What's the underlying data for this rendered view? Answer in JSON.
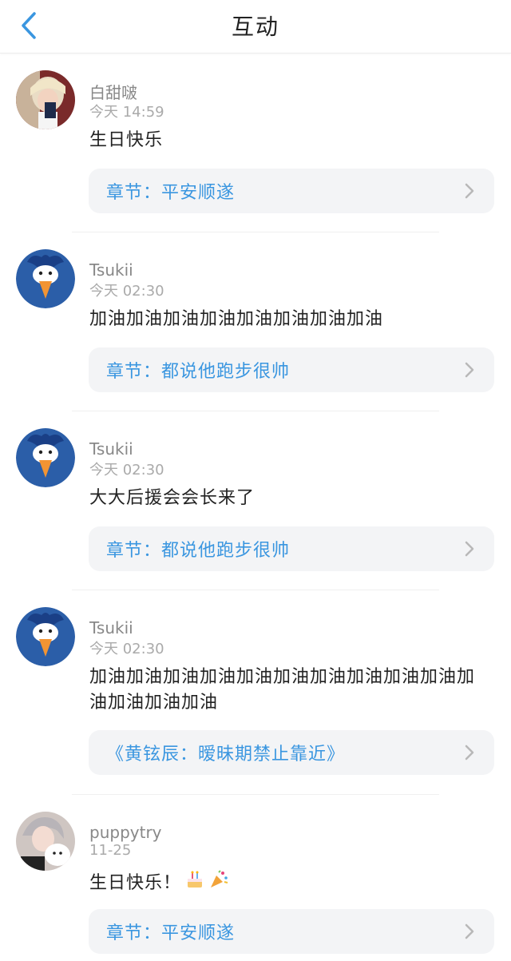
{
  "header": {
    "title": "互动"
  },
  "comments": [
    {
      "username": "白甜啵",
      "time": "今天 14:59",
      "content": "生日快乐",
      "chapter": "章节：平安顺遂"
    },
    {
      "username": "Tsukii",
      "time": "今天 02:30",
      "content": "加油加油加油加油加油加油加油加油",
      "chapter": "章节：都说他跑步很帅"
    },
    {
      "username": "Tsukii",
      "time": "今天 02:30",
      "content": "大大后援会会长来了",
      "chapter": "章节：都说他跑步很帅"
    },
    {
      "username": "Tsukii",
      "time": "今天 02:30",
      "content": "加油加油加油加油加油加油加油加油加油加油加油加油加油加油",
      "chapter": "《黄铉辰：暧昧期禁止靠近》"
    },
    {
      "username": "puppytry",
      "time": "11-25",
      "content": "生日快乐！",
      "chapter": "章节：平安顺遂"
    }
  ],
  "colors": {
    "accent": "#3a96e0",
    "card": "#f3f4f6"
  },
  "icons": {
    "back": "chevron-left-icon",
    "chapter_arrow": "chevron-right-icon",
    "emoji1": "cake-emoji",
    "emoji2": "party-popper-emoji"
  }
}
